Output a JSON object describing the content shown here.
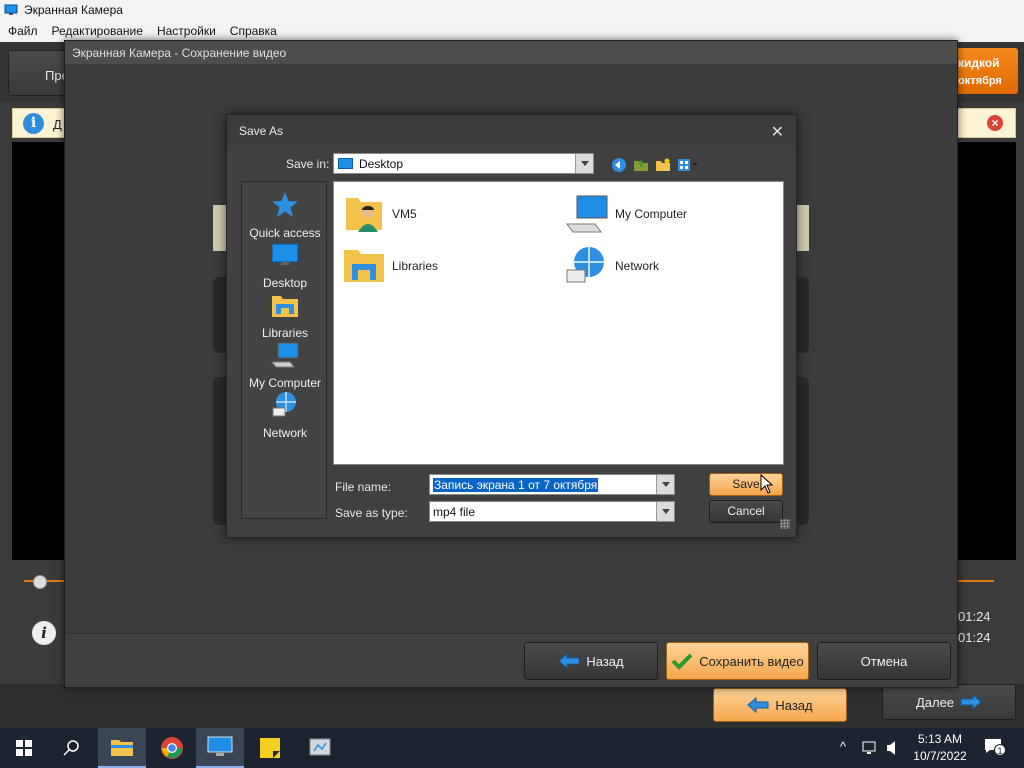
{
  "app": {
    "title": "Экранная Камера",
    "menu": [
      "Файл",
      "Редактирование",
      "Настройки",
      "Справка"
    ],
    "tab_left_label": "Про",
    "promo_line1": "кидкой",
    "promo_line2": "октября",
    "info_text": "Д",
    "time1": "01:24",
    "time2": "01:24",
    "back_label": "Назад",
    "next_label": "Далее"
  },
  "save_dialog": {
    "title": "Экранная Камера - Сохранение видео",
    "back_label": "Назад",
    "save_label": "Сохранить видео",
    "cancel_label": "Отмена"
  },
  "save_as": {
    "title": "Save As",
    "save_in_label": "Save in:",
    "save_in_value": "Desktop",
    "places": [
      {
        "label": "Quick access",
        "icon": "star-icon"
      },
      {
        "label": "Desktop",
        "icon": "desktop-icon"
      },
      {
        "label": "Libraries",
        "icon": "libraries-icon"
      },
      {
        "label": "My Computer",
        "icon": "computer-icon"
      },
      {
        "label": "Network",
        "icon": "network-icon"
      }
    ],
    "files": [
      {
        "label": "VM5",
        "icon": "user-folder-icon"
      },
      {
        "label": "My Computer",
        "icon": "computer-icon"
      },
      {
        "label": "Libraries",
        "icon": "libraries-icon"
      },
      {
        "label": "Network",
        "icon": "network-icon"
      }
    ],
    "file_name_label": "File name:",
    "file_name_value": "Запись экрана 1 от 7 октября",
    "save_as_type_label": "Save as type:",
    "save_as_type_value": "mp4 file",
    "save_button": "Save",
    "cancel_button": "Cancel"
  },
  "taskbar": {
    "time": "5:13 AM",
    "date": "10/7/2022",
    "notification_count": "1"
  }
}
